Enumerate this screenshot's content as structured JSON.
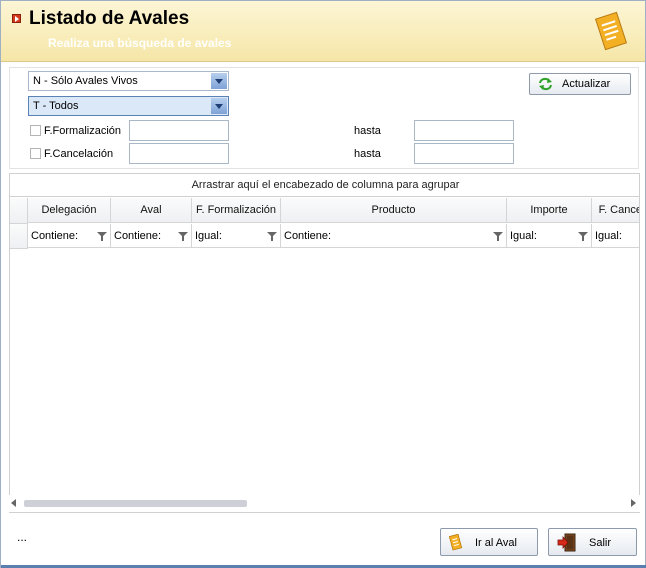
{
  "header": {
    "title": "Listado de Avales",
    "subtitle": "Realiza una búsqueda de avales"
  },
  "filters": {
    "status_combo": "N - Sólo Avales Vivos",
    "type_combo": "T - Todos",
    "formalizacion_label": "F.Formalización",
    "cancelacion_label": "F.Cancelación",
    "hasta_label": "hasta",
    "refresh_label": "Actualizar"
  },
  "grid": {
    "group_panel": "Arrastrar aquí el encabezado de columna para agrupar",
    "columns": [
      {
        "label": "Delegación",
        "filter": "Contiene:"
      },
      {
        "label": "Aval",
        "filter": "Contiene:"
      },
      {
        "label": "F. Formalización",
        "filter": "Igual:"
      },
      {
        "label": "Producto",
        "filter": "Contiene:"
      },
      {
        "label": "Importe",
        "filter": "Igual:"
      },
      {
        "label": "F. Cancel",
        "filter": "Igual:"
      }
    ]
  },
  "footer": {
    "status": "...",
    "goto_label": "Ir al Aval",
    "exit_label": "Salir"
  },
  "colors": {
    "header_bg": "#f5e6a7",
    "accent": "#5b82b5"
  }
}
